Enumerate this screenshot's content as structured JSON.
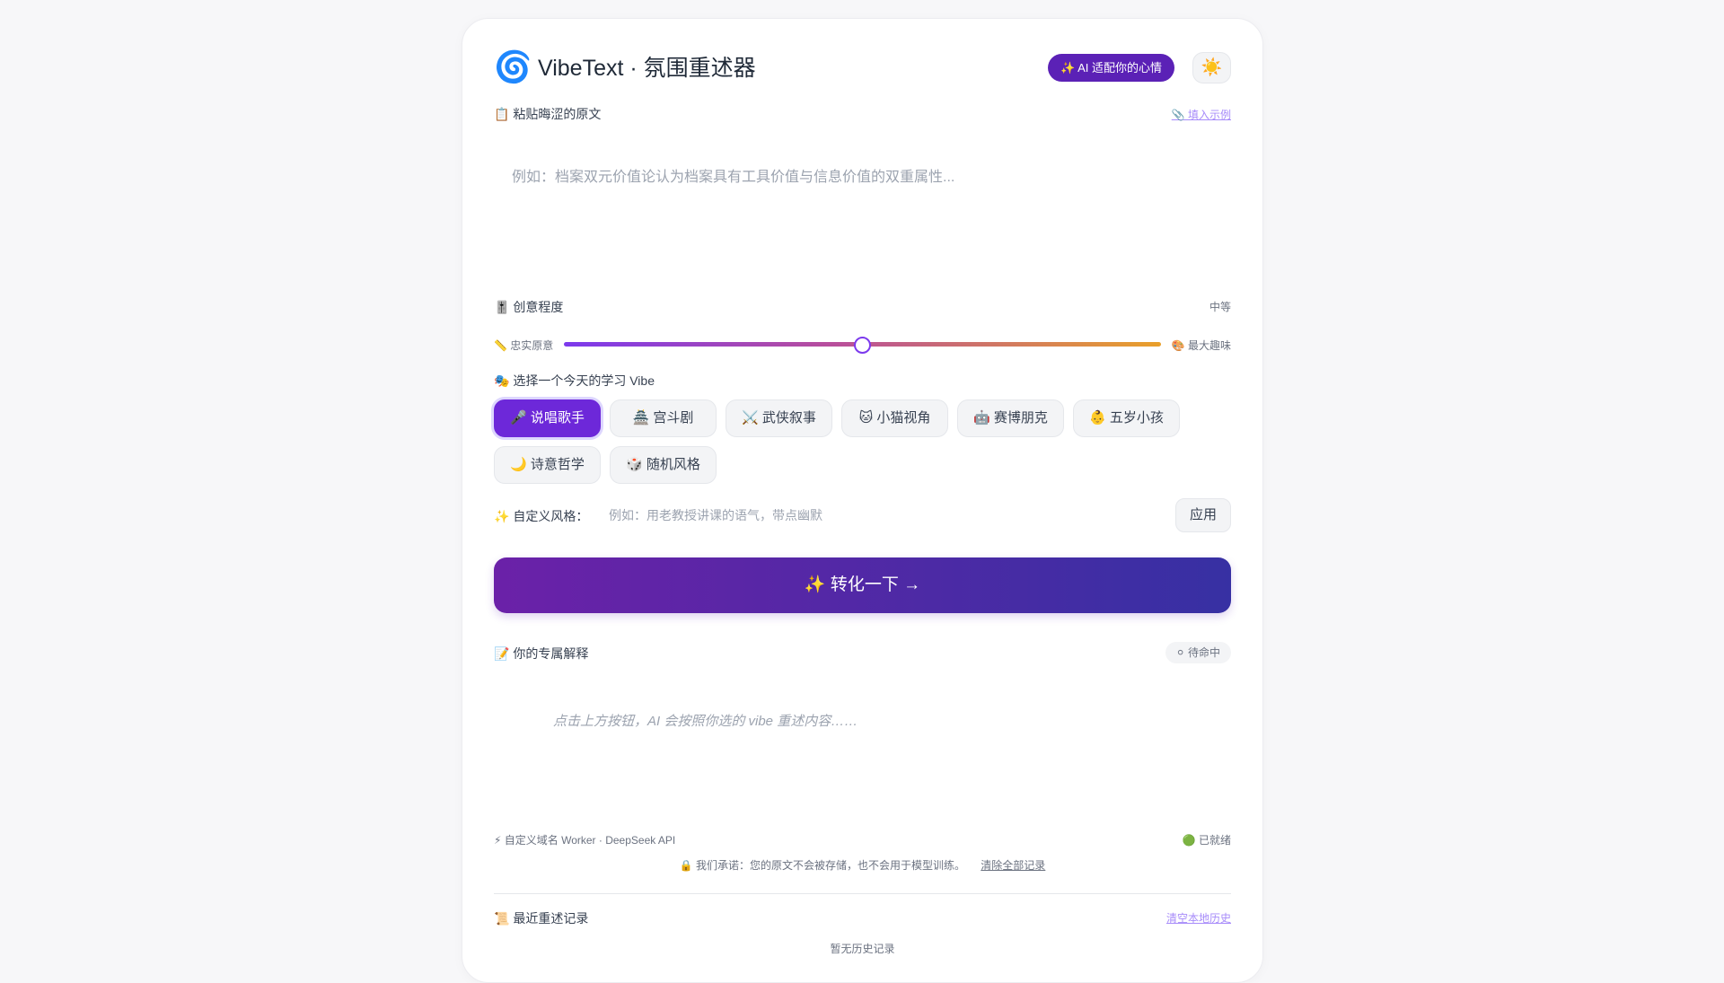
{
  "header": {
    "logo_icon": "🌀",
    "title": "VibeText · 氛围重述器",
    "ai_badge": "✨ AI 适配你的心情",
    "theme_toggle_icon": "☀️"
  },
  "source": {
    "label": "📋 粘贴晦涩的原文",
    "fill_example_link": "📎 填入示例",
    "placeholder": "例如：档案双元价值论认为档案具有工具价值与信息价值的双重属性..."
  },
  "creativity": {
    "label": "🎚️ 创意程度",
    "level_text": "中等",
    "left_label": "📏 忠实原意",
    "right_label": "🎨 最大趣味",
    "value": 0.5
  },
  "vibes": {
    "label": "🎭 选择一个今天的学习 Vibe",
    "items": [
      {
        "label": "🎤 说唱歌手",
        "active": true
      },
      {
        "label": "🏯 宫斗剧",
        "active": false
      },
      {
        "label": "⚔️ 武侠叙事",
        "active": false
      },
      {
        "label": "🐱 小猫视角",
        "active": false
      },
      {
        "label": "🤖 赛博朋克",
        "active": false
      },
      {
        "label": "👶 五岁小孩",
        "active": false
      },
      {
        "label": "🌙 诗意哲学",
        "active": false
      },
      {
        "label": "🎲 随机风格",
        "active": false
      }
    ]
  },
  "custom_style": {
    "label": "✨ 自定义风格：",
    "placeholder": "例如：用老教授讲课的语气，带点幽默",
    "apply_label": "应用"
  },
  "convert_button": "✨ 转化一下 →",
  "output": {
    "label": "📝 你的专属解释",
    "status": "⚪ 待命中",
    "hint": "点击上方按钮，AI 会按照你选的 vibe 重述内容……"
  },
  "footer": {
    "engine": "⚡ 自定义域名 Worker · DeepSeek API",
    "ready_status": "🟢 已就绪",
    "promise": "🔒 我们承诺：您的原文不会被存储，也不会用于模型训练。",
    "clear_all_link": "清除全部记录"
  },
  "history": {
    "label": "📜 最近重述记录",
    "clear_link": "清空本地历史",
    "empty_text": "暂无历史记录"
  },
  "colors": {
    "accent": "#6d28d9",
    "badge": "#5b21b6",
    "link": "#a78bfa"
  }
}
